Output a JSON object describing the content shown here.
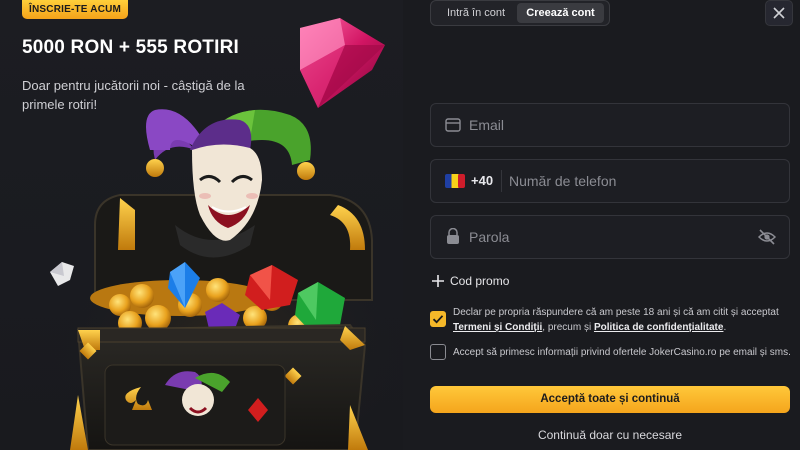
{
  "promo": {
    "badge": "ÎNSCRIE-TE ACUM",
    "headline": "5000 RON + 555 ROTIRI",
    "subtext": "Doar pentru jucătorii noi - câștigă de la primele rotiri!"
  },
  "tabs": [
    {
      "label": "Intră în cont",
      "active": false
    },
    {
      "label": "Creează cont",
      "active": true
    }
  ],
  "form": {
    "email_placeholder": "Email",
    "phone_prefix": "+40",
    "phone_placeholder": "Număr de telefon",
    "password_placeholder": "Parola",
    "promo_code_label": "Cod promo",
    "consent_terms": {
      "checked": true,
      "text_before": "Declar pe propria răspundere că am peste 18 ani și că am citit și acceptat",
      "link_terms": "Termeni și Condiții",
      "text_middle": ", precum și",
      "link_privacy": "Politica de confidențialitate",
      "text_after": "."
    },
    "consent_marketing": {
      "checked": false,
      "text": "Accept să primesc informații privind ofertele JokerCasino.ro pe email și sms."
    },
    "accept_all_button": "Acceptă toate și continuă",
    "necessary_only_link": "Continuă doar cu necesare"
  },
  "colors": {
    "accent": "#f5b829",
    "background": "#1a1b1f"
  },
  "icons": [
    "close-icon",
    "email-icon",
    "romania-flag-icon",
    "lock-icon",
    "eye-off-icon",
    "plus-icon",
    "checkmark-icon"
  ]
}
